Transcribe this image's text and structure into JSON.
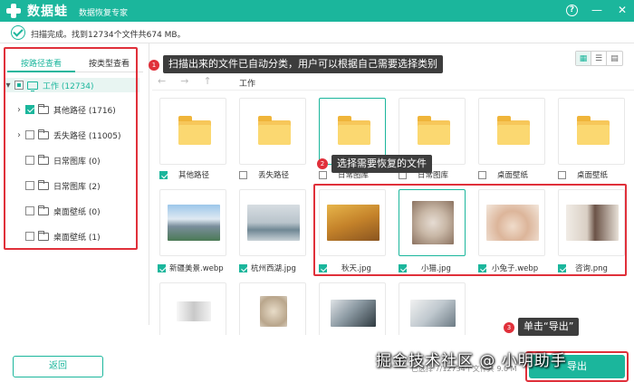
{
  "titlebar": {
    "app_name": "数据蛙",
    "subtitle": "数据恢复专家",
    "help_icon": "?",
    "minimize_icon": "—",
    "close_icon": "✕"
  },
  "status": {
    "text": "扫描完成。找到12734个文件共674 MB。"
  },
  "sidebar": {
    "tabs": [
      "按路径查看",
      "按类型查看"
    ],
    "root": {
      "label": "工作 (12734)"
    },
    "items": [
      {
        "label": "其他路径 (1716)",
        "expandable": true,
        "state": "checked"
      },
      {
        "label": "丢失路径 (11005)",
        "expandable": true,
        "state": "unchecked"
      },
      {
        "label": "日常图库 (0)",
        "expandable": false,
        "state": "unchecked"
      },
      {
        "label": "日常图库 (2)",
        "expandable": false,
        "state": "unchecked"
      },
      {
        "label": "桌面壁纸 (0)",
        "expandable": false,
        "state": "unchecked"
      },
      {
        "label": "桌面壁纸 (1)",
        "expandable": false,
        "state": "unchecked"
      }
    ],
    "back_label": "返回"
  },
  "navbar": {
    "path": "工作"
  },
  "grid": {
    "folders": [
      {
        "label": "其他路径",
        "state": "checked"
      },
      {
        "label": "丢失路径",
        "state": "unchecked"
      },
      {
        "label": "日常图库",
        "state": "unchecked"
      },
      {
        "label": "日常图库",
        "state": "unchecked"
      },
      {
        "label": "桌面壁纸",
        "state": "unchecked"
      },
      {
        "label": "桌面壁纸",
        "state": "unchecked"
      }
    ],
    "images_row1": [
      {
        "label": "新疆美景.webp",
        "state": "checked"
      },
      {
        "label": "杭州西湖.jpg",
        "state": "checked"
      },
      {
        "label": "秋天.jpg",
        "state": "checked"
      },
      {
        "label": "小猫.jpg",
        "state": "checked"
      },
      {
        "label": "小兔子.webp",
        "state": "checked"
      },
      {
        "label": "咨询.png",
        "state": "checked"
      }
    ]
  },
  "callouts": {
    "c1_num": "1",
    "c1_text": "扫描出来的文件已自动分类，用户可以根据自己需要选择类别",
    "c2_num": "2",
    "c2_text": "选择需要恢复的文件",
    "c3_num": "3",
    "c3_text": "单击“导出”"
  },
  "footer": {
    "export_label": "导出",
    "summary": "已选择 7/12734个文件共 9.0 M",
    "watermark": "掘金技术社区 @ 小明助手"
  },
  "colors": {
    "accent": "#1bb69c",
    "annotation_red": "#e0303a",
    "folder_yellow": "#f7c75a"
  }
}
